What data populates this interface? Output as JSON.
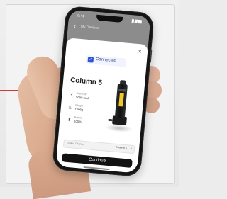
{
  "phone": {
    "time": "9:41",
    "background_nav_title": "My Devices",
    "background_back_symbol": "‹",
    "modal": {
      "close_symbol": "×",
      "connected_icon": "check-icon",
      "connected_text": "Connected",
      "device_name": "Column 5",
      "stats": [
        {
          "icon": "bolt-icon",
          "symbol": "⚡",
          "label": "Capacity",
          "value": "5000 mAh"
        },
        {
          "icon": "weight-icon",
          "symbol": "◫",
          "label": "Weight",
          "value": "1000g"
        },
        {
          "icon": "battery-icon",
          "symbol": "▮",
          "label": "Battery",
          "value": "100%"
        }
      ],
      "selector": {
        "label": "Select Channel",
        "value": "Channel 5",
        "chevron": "›"
      },
      "continue_label": "Continue"
    }
  },
  "colors": {
    "accent": "#2f54d7",
    "battery_yellow": "#f0c72d",
    "button_black": "#121212",
    "red_rule": "#cf3b35"
  }
}
